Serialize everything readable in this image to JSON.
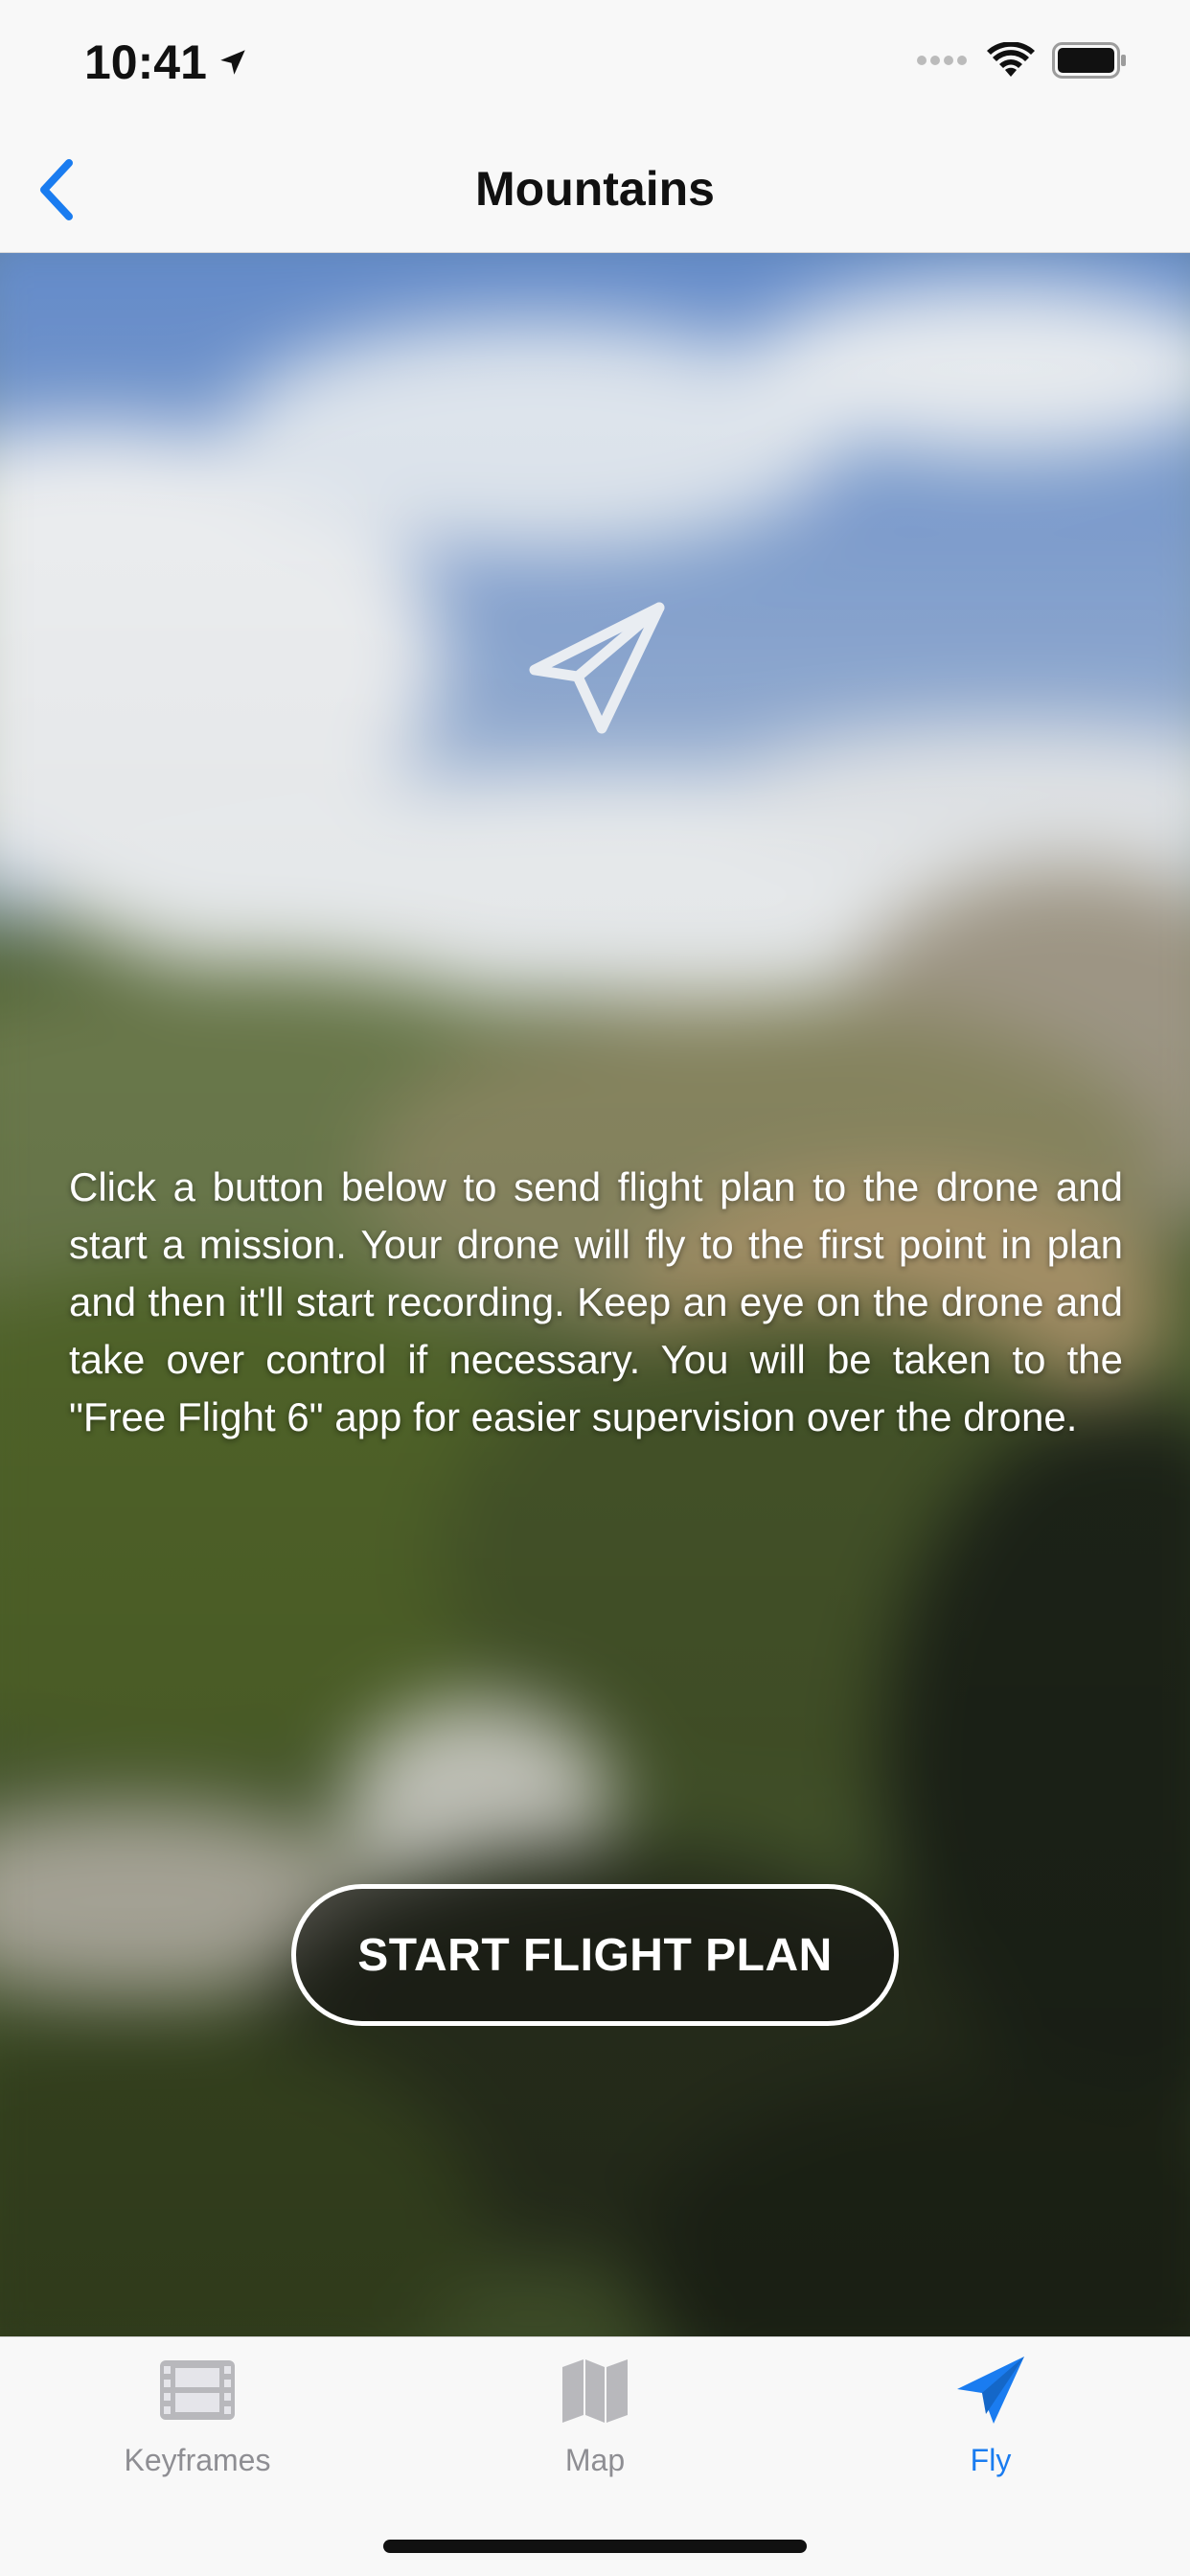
{
  "status_bar": {
    "time": "10:41"
  },
  "nav": {
    "title": "Mountains"
  },
  "main": {
    "description": "Click a button below to send flight plan to the drone and start a mission. Your drone will fly to the first point in plan and then it'll start recording. Keep an eye on the drone and take over control if necessary. You will be taken to the \"Free Flight 6\" app for easier supervision over the drone.",
    "start_button_label": "START FLIGHT PLAN"
  },
  "tabs": [
    {
      "label": "Keyframes",
      "icon": "film-icon",
      "active": false
    },
    {
      "label": "Map",
      "icon": "map-icon",
      "active": false
    },
    {
      "label": "Fly",
      "icon": "paper-plane-icon",
      "active": true
    }
  ],
  "colors": {
    "accent": "#1a7cf0",
    "inactive": "#8e8e93"
  }
}
